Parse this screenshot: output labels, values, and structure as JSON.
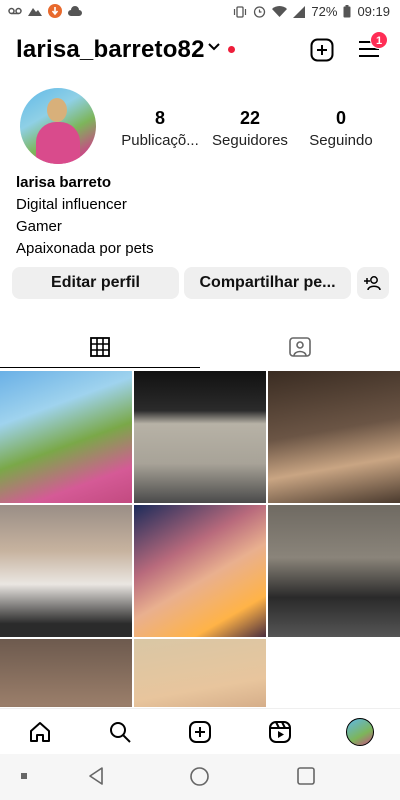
{
  "status_bar": {
    "battery": "72%",
    "time": "09:19"
  },
  "header": {
    "username": "larisa_barreto82",
    "notification_count": "1",
    "icons": [
      "chevron-down-icon",
      "create-post-icon",
      "menu-icon"
    ]
  },
  "profile": {
    "stats": [
      {
        "value": "8",
        "label": "Publicaçõ..."
      },
      {
        "value": "22",
        "label": "Seguidores"
      },
      {
        "value": "0",
        "label": "Seguindo"
      }
    ],
    "name": "larisa barreto",
    "bio_lines": [
      "Digital influencer",
      "Gamer",
      "Apaixonada por pets"
    ]
  },
  "actions": {
    "edit_label": "Editar perfil",
    "share_label": "Compartilhar pe...",
    "discover_icon": "add-person-icon"
  },
  "tabs": [
    "grid-icon",
    "tagged-icon"
  ],
  "grid": {
    "photo_count": 8
  },
  "bottom_nav": [
    "home-icon",
    "search-icon",
    "create-icon",
    "reels-icon",
    "profile-avatar"
  ],
  "colors": {
    "accent_red": "#ee1d3a",
    "button_bg": "#efefef"
  }
}
